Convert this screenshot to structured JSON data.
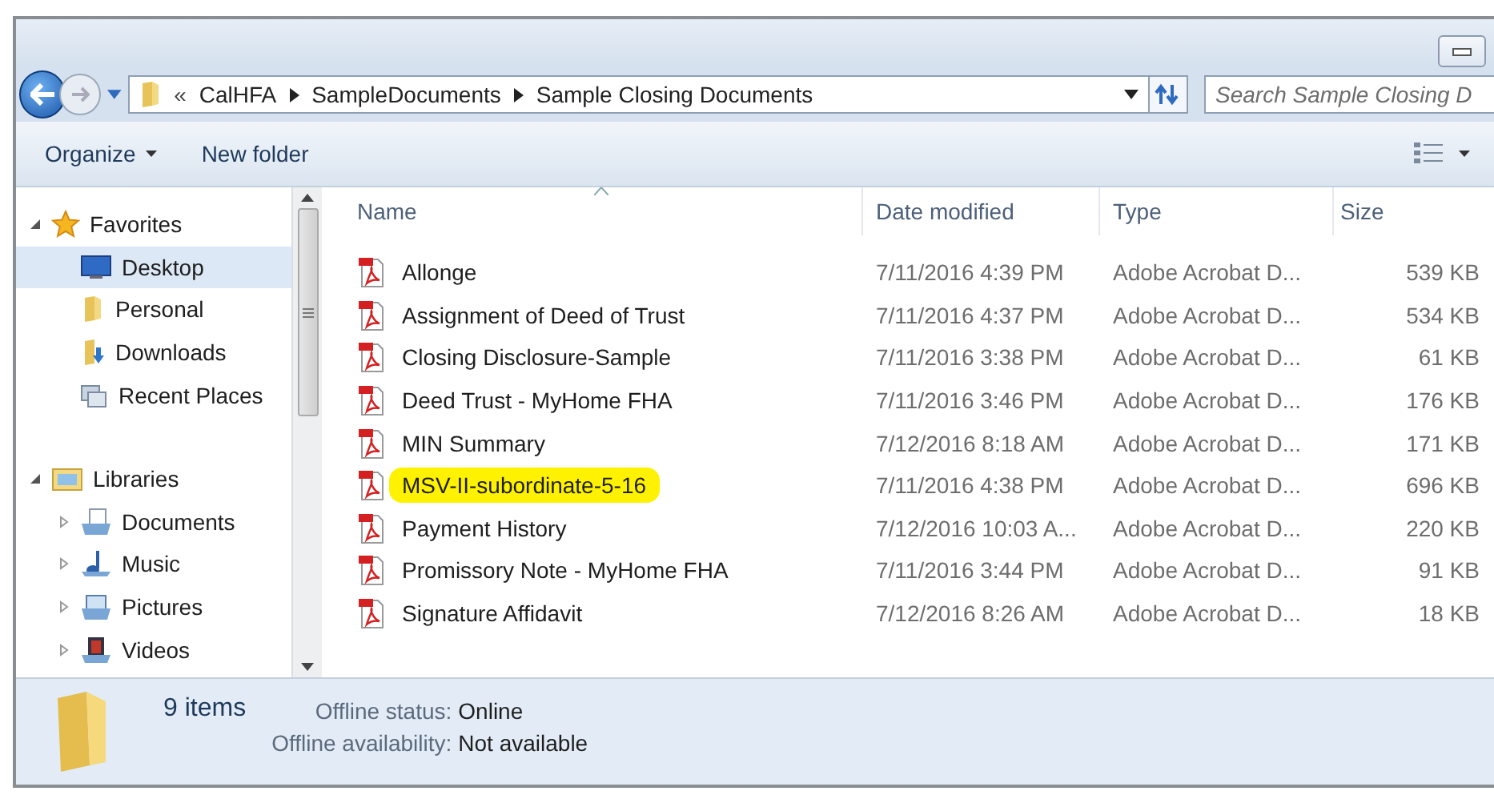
{
  "address_bar": {
    "overflow": "«",
    "crumbs": [
      "CalHFA",
      "SampleDocuments",
      "Sample Closing Documents"
    ]
  },
  "search": {
    "placeholder": "Search Sample Closing D"
  },
  "toolbar": {
    "organize": "Organize",
    "new_folder": "New folder"
  },
  "nav": [
    {
      "label": "Favorites",
      "kind": "group",
      "expanded": true,
      "children": [
        {
          "label": "Desktop",
          "kind": "desktop",
          "selected": true
        },
        {
          "label": "Personal",
          "kind": "folder",
          "selected": false
        },
        {
          "label": "Downloads",
          "kind": "downloads",
          "selected": false
        },
        {
          "label": "Recent Places",
          "kind": "recent",
          "selected": false
        }
      ]
    },
    {
      "label": "Libraries",
      "kind": "library",
      "expanded": true,
      "children": [
        {
          "label": "Documents",
          "kind": "documents",
          "selected": false,
          "expanded": false
        },
        {
          "label": "Music",
          "kind": "music",
          "selected": false,
          "expanded": false
        },
        {
          "label": "Pictures",
          "kind": "pictures",
          "selected": false,
          "expanded": false
        },
        {
          "label": "Videos",
          "kind": "videos",
          "selected": false,
          "expanded": false
        }
      ]
    }
  ],
  "table": {
    "columns": [
      "Name",
      "Date modified",
      "Type",
      "Size"
    ],
    "rows": [
      {
        "name": "Allonge",
        "date": "7/11/2016 4:39 PM",
        "type": "Adobe Acrobat D...",
        "size": "539 KB",
        "highlighted": false
      },
      {
        "name": "Assignment of Deed of Trust",
        "date": "7/11/2016 4:37 PM",
        "type": "Adobe Acrobat D...",
        "size": "534 KB",
        "highlighted": false
      },
      {
        "name": "Closing Disclosure-Sample",
        "date": "7/11/2016 3:38 PM",
        "type": "Adobe Acrobat D...",
        "size": "61 KB",
        "highlighted": false
      },
      {
        "name": "Deed Trust - MyHome FHA",
        "date": "7/11/2016 3:46 PM",
        "type": "Adobe Acrobat D...",
        "size": "176 KB",
        "highlighted": false
      },
      {
        "name": "MIN Summary",
        "date": "7/12/2016 8:18 AM",
        "type": "Adobe Acrobat D...",
        "size": "171 KB",
        "highlighted": false
      },
      {
        "name": "MSV-II-subordinate-5-16",
        "date": "7/11/2016 4:38 PM",
        "type": "Adobe Acrobat D...",
        "size": "696 KB",
        "highlighted": true
      },
      {
        "name": "Payment History",
        "date": "7/12/2016 10:03 A...",
        "type": "Adobe Acrobat D...",
        "size": "220 KB",
        "highlighted": false
      },
      {
        "name": "Promissory Note - MyHome FHA",
        "date": "7/11/2016 3:44 PM",
        "type": "Adobe Acrobat D...",
        "size": "91 KB",
        "highlighted": false
      },
      {
        "name": "Signature Affidavit",
        "date": "7/12/2016 8:26 AM",
        "type": "Adobe Acrobat D...",
        "size": "18 KB",
        "highlighted": false
      }
    ]
  },
  "status_bar": {
    "count": "9 items",
    "fields": [
      {
        "label": "Offline status:",
        "value": "Online"
      },
      {
        "label": "Offline availability:",
        "value": "Not available"
      }
    ]
  }
}
